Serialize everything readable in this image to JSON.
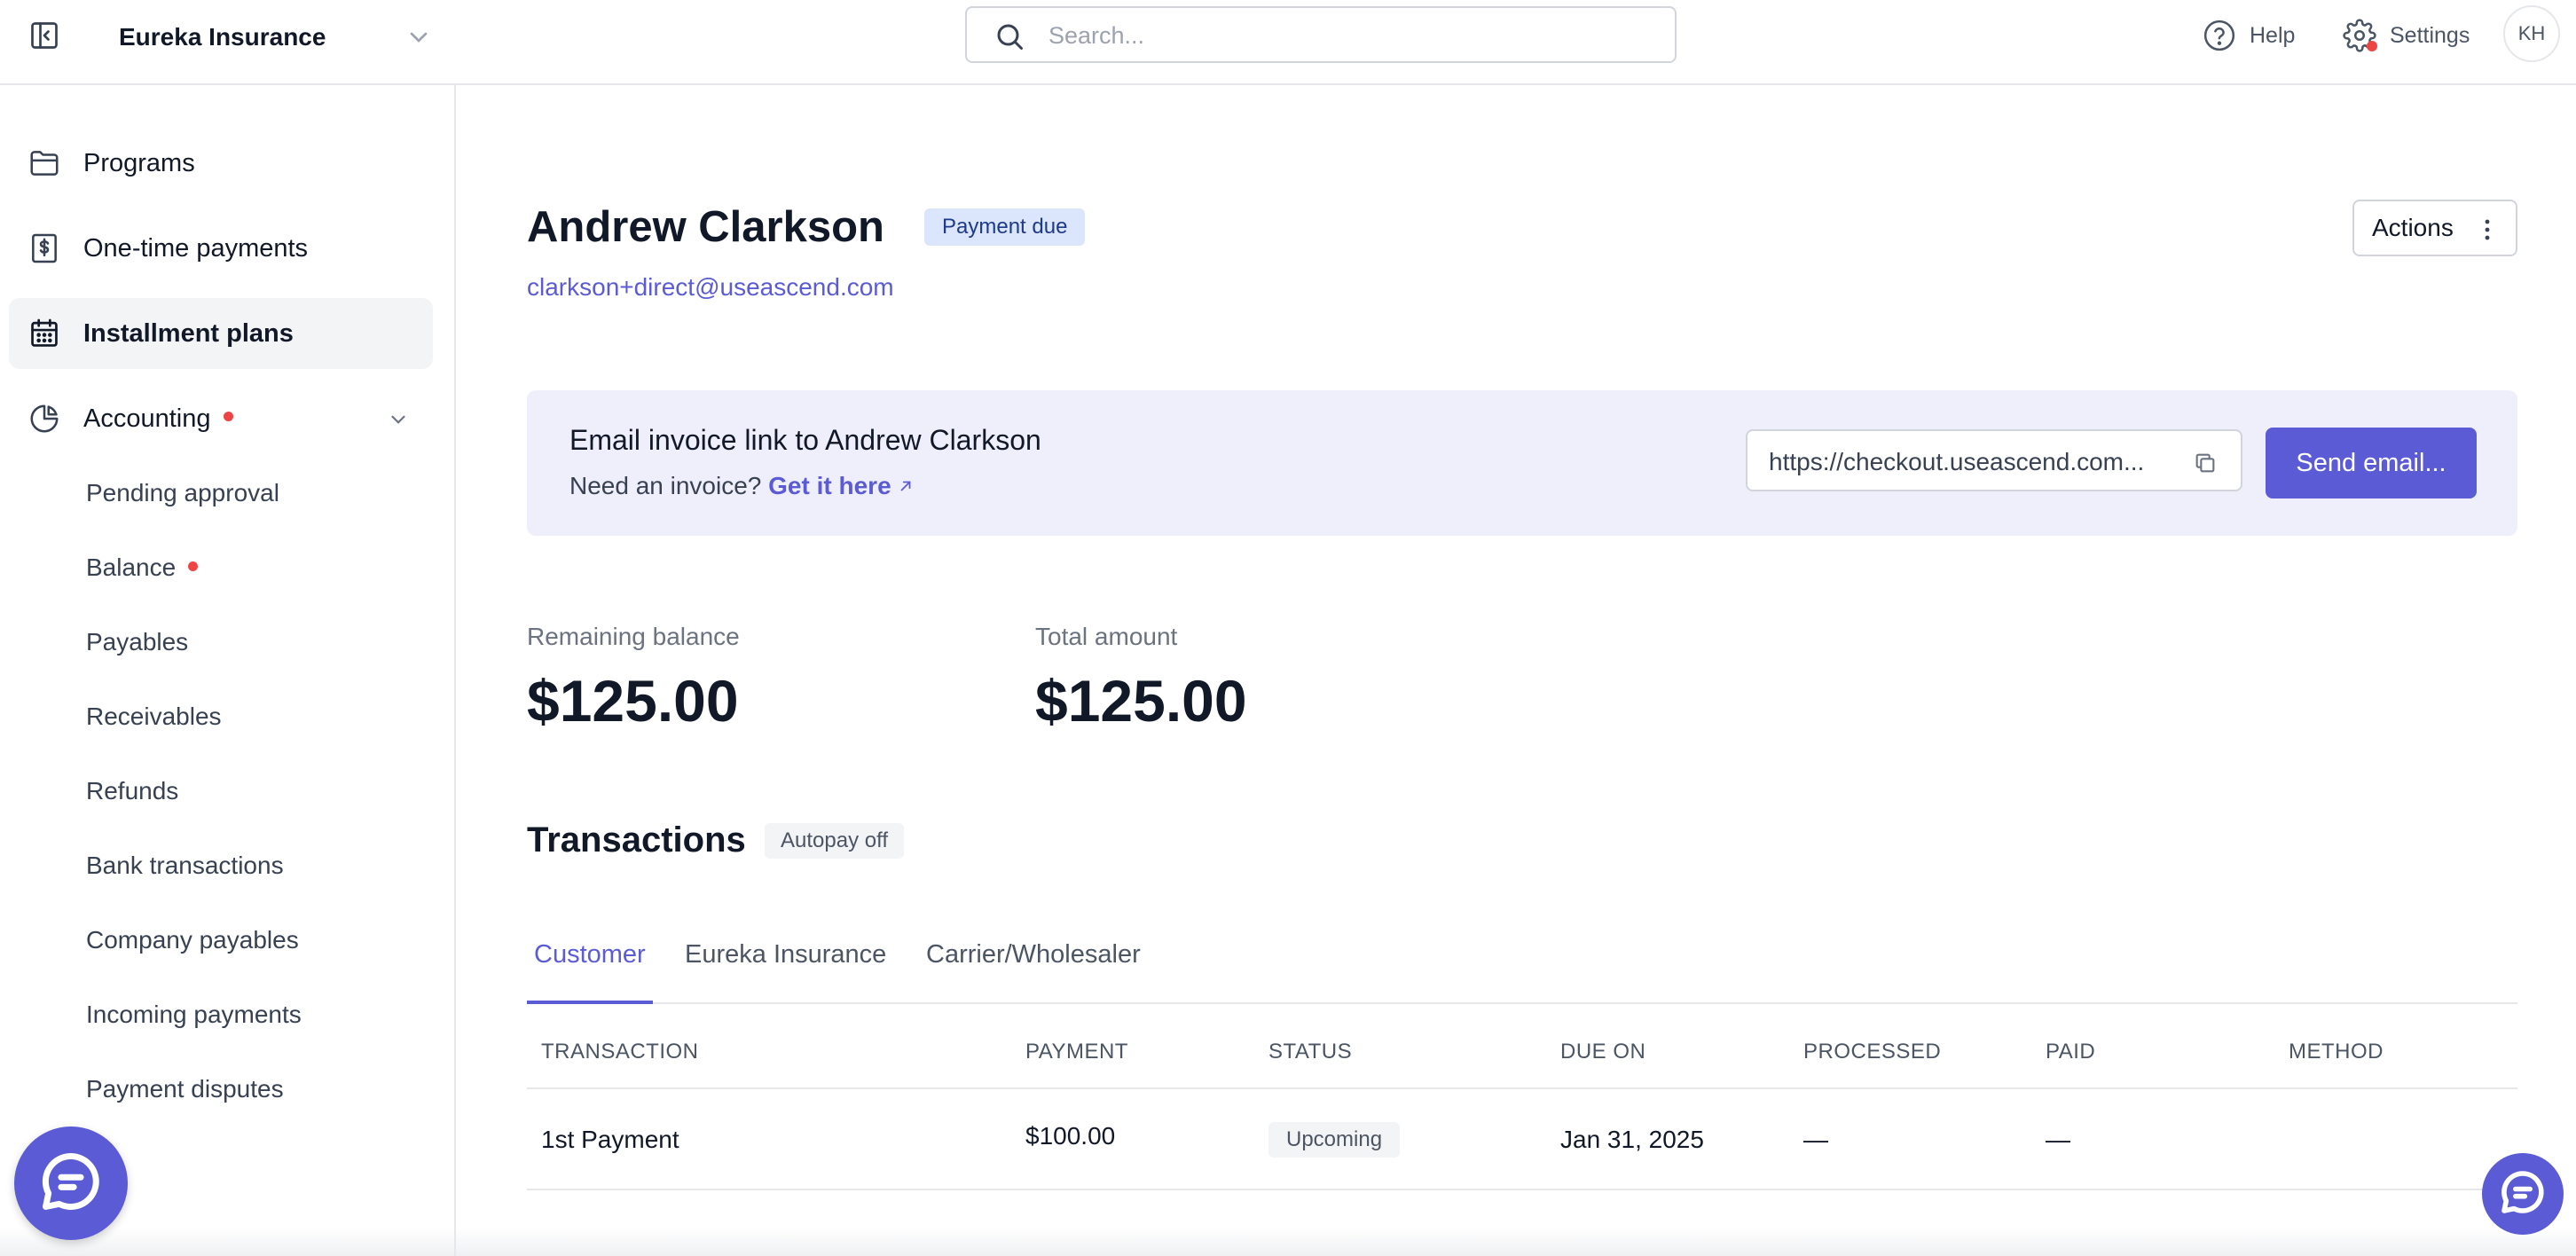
{
  "header": {
    "org_name": "Eureka Insurance",
    "search_placeholder": "Search...",
    "help_label": "Help",
    "settings_label": "Settings",
    "avatar_initials": "KH"
  },
  "sidebar": {
    "items": [
      {
        "label": "Programs",
        "icon": "folder-icon"
      },
      {
        "label": "One-time payments",
        "icon": "dollar-receipt-icon"
      },
      {
        "label": "Installment plans",
        "icon": "calendar-icon",
        "active": true
      },
      {
        "label": "Accounting",
        "icon": "pie-chart-icon",
        "has_notification": true
      }
    ],
    "accounting_subitems": [
      "Pending approval",
      "Balance",
      "Payables",
      "Receivables",
      "Refunds",
      "Bank transactions",
      "Company payables",
      "Incoming payments",
      "Payment disputes"
    ]
  },
  "customer": {
    "name": "Andrew Clarkson",
    "status": "Payment due",
    "email": "clarkson+direct@useascend.com",
    "actions_label": "Actions"
  },
  "invoice": {
    "title": "Email invoice link to Andrew Clarkson",
    "need_invoice": "Need an invoice?",
    "get_it_here": "Get it here",
    "url": "https://checkout.useascend.com...",
    "send_label": "Send email..."
  },
  "stats": {
    "remaining_label": "Remaining balance",
    "remaining_value": "$125.00",
    "total_label": "Total amount",
    "total_value": "$125.00"
  },
  "transactions": {
    "title": "Transactions",
    "autopay": "Autopay off",
    "tabs": [
      "Customer",
      "Eureka Insurance",
      "Carrier/Wholesaler"
    ],
    "columns": [
      "TRANSACTION",
      "PAYMENT",
      "STATUS",
      "DUE ON",
      "PROCESSED",
      "PAID",
      "METHOD"
    ],
    "rows": [
      {
        "transaction": "1st Payment",
        "payment": "$100.00",
        "status": "Upcoming",
        "due_on": "Jan 31, 2025",
        "processed": "—",
        "paid": "—",
        "method": ""
      }
    ]
  },
  "colors": {
    "accent": "#5b5bd6",
    "notification": "#ef4444",
    "panel_bg": "#efeefb"
  }
}
